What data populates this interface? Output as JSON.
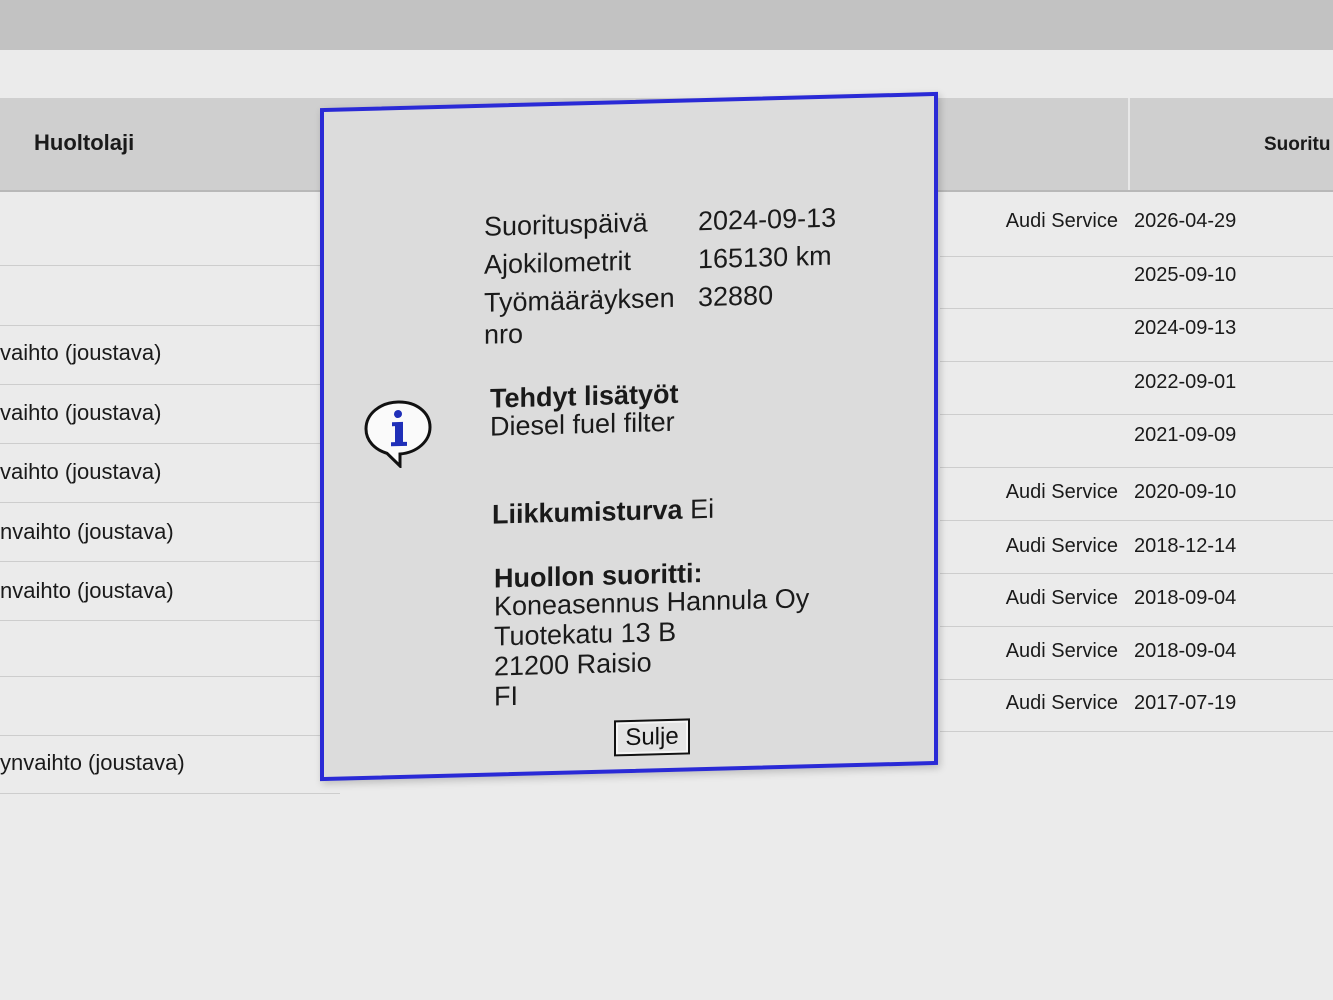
{
  "table": {
    "header_left": "Huoltolaji",
    "header_right": "Suoritu",
    "left_rows": [
      "vaihto (joustava)",
      "vaihto (joustava)",
      "vaihto (joustava)",
      "nvaihto (joustava)",
      "nvaihto (joustava)",
      "ynvaihto (joustava)"
    ],
    "right_rows": [
      {
        "provider": "Audi Service",
        "date": "2026-04-29"
      },
      {
        "provider": "",
        "date": "2025-09-10"
      },
      {
        "provider": "",
        "date": "2024-09-13"
      },
      {
        "provider": "",
        "date": "2022-09-01"
      },
      {
        "provider": "",
        "date": "2021-09-09"
      },
      {
        "provider": "Audi Service",
        "date": "2020-09-10"
      },
      {
        "provider": "Audi Service",
        "date": "2018-12-14"
      },
      {
        "provider": "Audi Service",
        "date": "2018-09-04"
      },
      {
        "provider": "Audi Service",
        "date": "2018-09-04"
      },
      {
        "provider": "Audi Service",
        "date": "2017-07-19"
      }
    ]
  },
  "dialog": {
    "icon": "info-icon",
    "fields": {
      "date_label": "Suorituspäivä",
      "date_value": "2024-09-13",
      "km_label": "Ajokilometrit",
      "km_value": "165130 km",
      "order_label_line1": "Työmääräyksen",
      "order_label_line2": "nro",
      "order_value": "32880"
    },
    "extra_work_heading": "Tehdyt lisätyöt",
    "extra_work_value": "Diesel fuel filter",
    "mobility_label": "Liikkumisturva",
    "mobility_value": "Ei",
    "performer_heading": "Huollon suoritti:",
    "performer_lines": [
      "Koneasennus Hannula Oy",
      "Tuotekatu 13 B",
      "21200 Raisio",
      "FI"
    ],
    "close_label": "Sulje"
  },
  "colors": {
    "dialog_border": "#2a2ad6",
    "dialog_bg": "#dcdcdc",
    "header_bg": "#cfcfcf"
  }
}
